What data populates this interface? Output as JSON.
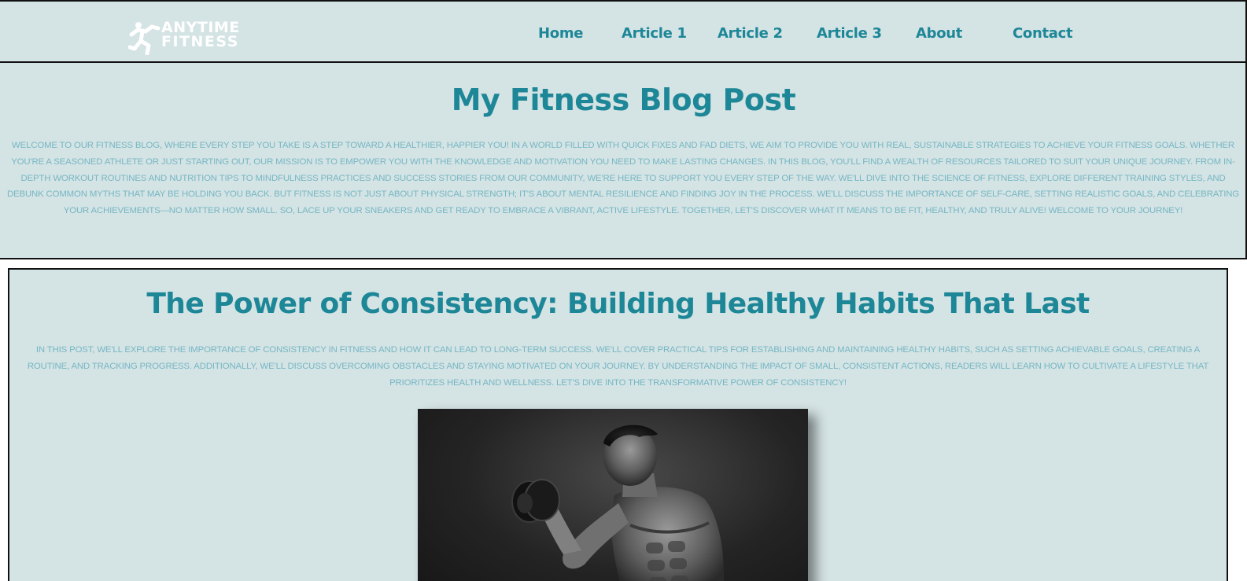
{
  "brand": {
    "line1": "ANYTIME",
    "line2": "FITNESS",
    "logo_icon": "running-man-icon",
    "color": "#ffffff"
  },
  "nav": {
    "items": [
      {
        "label": "Home"
      },
      {
        "label": "Article 1"
      },
      {
        "label": "Article 2"
      },
      {
        "label": "Article 3"
      },
      {
        "label": "About"
      },
      {
        "label": "Contact"
      }
    ]
  },
  "hero": {
    "title": "My Fitness Blog Post",
    "intro": "Welcome to our fitness blog, where every step you take is a step toward a healthier, happier you! In a world filled with quick fixes and fad diets, we aim to provide you with real, sustainable strategies to achieve your fitness goals. Whether you're a seasoned athlete or just starting out, our mission is to empower you with the knowledge and motivation you need to make lasting changes. In this blog, you'll find a wealth of resources tailored to suit your unique journey. From in-depth workout routines and nutrition tips to mindfulness practices and success stories from our community, we're here to support you every step of the way. We'll dive into the science of fitness, explore different training styles, and debunk common myths that may be holding you back. But fitness is not just about physical strength; it's about mental resilience and finding joy in the process. We'll discuss the importance of self-care, setting realistic goals, and celebrating your achievements—no matter how small. So, lace up your sneakers and get ready to embrace a vibrant, active lifestyle. Together, let's discover what it means to be fit, healthy, and truly alive! Welcome to your journey!"
  },
  "article": {
    "title": "The Power of Consistency: Building Healthy Habits That Last",
    "summary": "In this post, we'll explore the importance of consistency in fitness and how it can lead to long-term success. We'll cover practical tips for establishing and maintaining healthy habits, such as setting achievable goals, creating a routine, and tracking progress. Additionally, we'll discuss overcoming obstacles and staying motivated on your journey. By understanding the impact of small, consistent actions, readers will learn how to cultivate a lifestyle that prioritizes health and wellness. Let's dive into the transformative power of consistency!",
    "image_subject": "man-lifting-dumbbell-photo"
  },
  "colors": {
    "background": "#d4e3e4",
    "accent": "#1d8797",
    "body_text": "#76b7c4"
  }
}
